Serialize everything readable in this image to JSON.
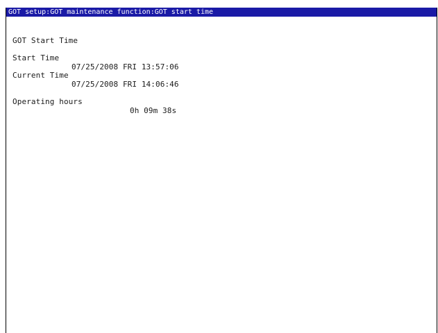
{
  "window": {
    "title": "GOT setup:GOT maintenance function:GOT start time"
  },
  "content": {
    "heading": "GOT Start Time",
    "start_time": {
      "label": "Start Time",
      "value": "07/25/2008 FRI 13:57:06"
    },
    "current_time": {
      "label": "Current Time",
      "value": "07/25/2008 FRI 14:06:46"
    },
    "operating_hours": {
      "label": "Operating hours",
      "value": "0h 09m 38s"
    }
  },
  "colors": {
    "title_bar_background": "#1a1aa6",
    "title_bar_text": "#ffffff",
    "screen_background": "#ffffff",
    "text": "#1a1a1a"
  }
}
